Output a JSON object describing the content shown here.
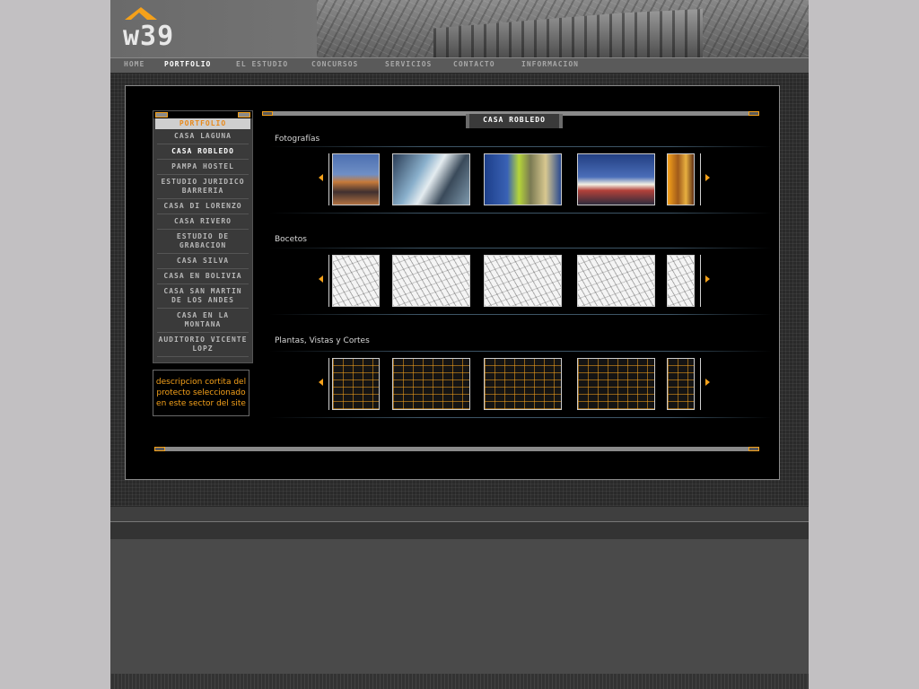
{
  "logo": {
    "text": "w39"
  },
  "nav": [
    {
      "label": "home",
      "active": false
    },
    {
      "label": "portfolio",
      "active": true
    },
    {
      "label": "el estudio",
      "active": false
    },
    {
      "label": "concursos",
      "active": false
    },
    {
      "label": "servicios",
      "active": false
    },
    {
      "label": "contacto",
      "active": false
    },
    {
      "label": "informacion",
      "active": false
    }
  ],
  "sidebar": {
    "heading": "PORTFOLIO",
    "items": [
      {
        "label": "CASA LAGUNA"
      },
      {
        "label": "CASA ROBLEDO"
      },
      {
        "label": "PAMPA HOSTEL"
      },
      {
        "label": "ESTUDIO JURIDICO BARRERIA"
      },
      {
        "label": "CASA DI LORENZO"
      },
      {
        "label": "CASA RIVERO"
      },
      {
        "label": "ESTUDIO DE GRABACION"
      },
      {
        "label": "CASA SILVA"
      },
      {
        "label": "CASA EN BOLIVIA"
      },
      {
        "label": "CASA SAN MARTIN DE LOS ANDES"
      },
      {
        "label": "CASA EN LA MONTANA"
      },
      {
        "label": "AUDITORIO VICENTE LOPZ"
      }
    ],
    "active_item": "CASA ROBLEDO"
  },
  "description": "descripcion cortita del protecto seleccionado en este sector del site",
  "project_title": "CASA ROBLEDO",
  "sections": [
    {
      "label": "Fotografías"
    },
    {
      "label": "Bocetos"
    },
    {
      "label": "Plantas, Vistas y Cortes"
    }
  ],
  "colors": {
    "accent": "#f5a11a",
    "panel": "#000000",
    "site_bg": "#4a4a4a"
  }
}
